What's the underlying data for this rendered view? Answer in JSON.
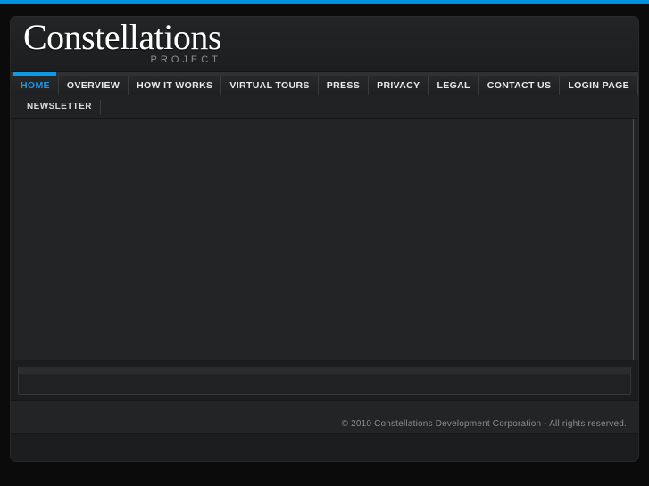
{
  "theme": {
    "accent_blue": "#0090e0",
    "nav_active_blue": "#2196e8",
    "page_background": "#0b0b0c",
    "shell_background": "#1c1d1e",
    "content_background": "#232425",
    "text_light": "#e9eaeb",
    "text_muted": "#8b8d8f"
  },
  "header": {
    "logo_word": "Constellations",
    "logo_sub": "PROJECT"
  },
  "nav": {
    "items": [
      {
        "label": "HOME",
        "active": true
      },
      {
        "label": "OVERVIEW",
        "active": false
      },
      {
        "label": "HOW IT WORKS",
        "active": false
      },
      {
        "label": "VIRTUAL TOURS",
        "active": false
      },
      {
        "label": "PRESS",
        "active": false
      },
      {
        "label": "PRIVACY",
        "active": false
      },
      {
        "label": "LEGAL",
        "active": false
      },
      {
        "label": "CONTACT US",
        "active": false
      },
      {
        "label": "LOGIN PAGE",
        "active": false
      }
    ]
  },
  "subnav": {
    "items": [
      {
        "label": "NEWSLETTER"
      }
    ]
  },
  "main": {
    "body_text": ""
  },
  "panel": {
    "content": ""
  },
  "footer": {
    "copyright": "© 2010 Constellations Development Corporation - All rights reserved."
  }
}
